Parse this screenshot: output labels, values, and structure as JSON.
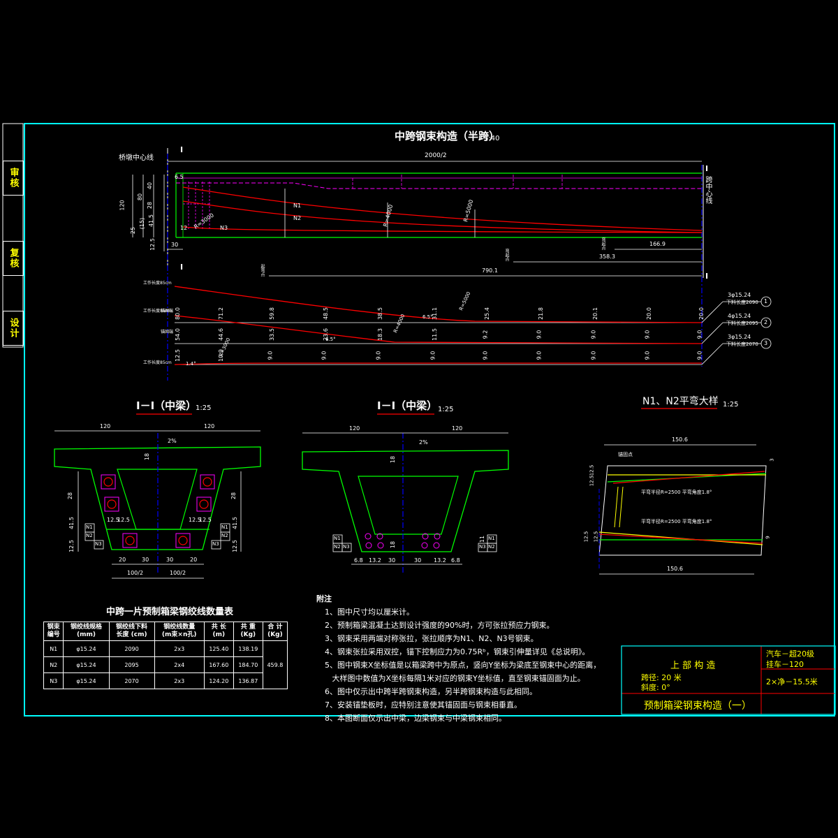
{
  "sidebar": {
    "items": [
      "审核",
      "复核",
      "设计"
    ]
  },
  "main_view": {
    "title": "中跨钢束构造（半跨）",
    "scale": "1:40",
    "span_dim": "2000/2",
    "pier_label": "桥墩中心线",
    "span_center_label": "跨中心线",
    "section_mark": "I",
    "dims_left": [
      "6.5",
      "120",
      "80",
      "40",
      "28",
      "41.5",
      "25",
      "(15)",
      "12.5",
      "12"
    ],
    "dims_bottom": [
      "30",
      "166.9",
      "358.3",
      "790.1"
    ],
    "tendon_labels": [
      "N1",
      "N2",
      "N3"
    ],
    "radius_labels": [
      "R=3000",
      "R=4000",
      "R=5000"
    ],
    "small_labels": [
      "弯起点",
      "弯起点",
      "起弯点"
    ]
  },
  "profiles": {
    "rows": [
      {
        "head": "工作长度85cm",
        "values": [
          "80.0",
          "71.2",
          "59.8",
          "48.5",
          "38.5",
          "31.1",
          "25.4",
          "21.8",
          "20.1",
          "20.0",
          "20.0"
        ],
        "spec": "3φ15.24",
        "length": "下料长度2090",
        "no": "1",
        "extra": "6.5°",
        "radius": "R=5000"
      },
      {
        "head": "工作长度85cm",
        "values": [
          "54.0",
          "44.6",
          "33.5",
          "23.6",
          "18.3",
          "11.5",
          "9.2",
          "9.0",
          "9.0",
          "9.0",
          "9.0"
        ],
        "spec": "4φ15.24",
        "length": "下料长度2095",
        "no": "2",
        "extra": "6.5°",
        "radius": "R=4000"
      },
      {
        "head": "工作长度85cm",
        "values": [
          "12.5",
          "10.9",
          "9.0",
          "9.0",
          "9.0",
          "9.0",
          "9.0",
          "9.0",
          "9.0",
          "9.0",
          "9.0"
        ],
        "spec": "3φ15.24",
        "length": "下料长度2070",
        "no": "3",
        "extra": "1.4°",
        "radius": "R=3000"
      }
    ],
    "row_caption": "锚固端"
  },
  "section_left": {
    "title": "I－I（中梁）",
    "scale": "1:25",
    "top_dims": [
      "120",
      "120"
    ],
    "slope": "2%",
    "dims": [
      "18",
      "28",
      "41.5",
      "12.5",
      "12.5",
      "12.5"
    ],
    "bottom_dims": [
      "20",
      "30",
      "30",
      "20"
    ],
    "half_widths": [
      "100/2",
      "100/2"
    ],
    "tags_left": [
      "N1",
      "N2",
      "N3"
    ],
    "tags_right": [
      "N1",
      "N2",
      "N3"
    ]
  },
  "section_right": {
    "title": "I－I（中梁）",
    "scale": "1:25",
    "top_dims": [
      "120",
      "120"
    ],
    "slope": "2%",
    "dims": [
      "18",
      "18",
      "11"
    ],
    "bottom_dims": [
      "6.8",
      "13.2",
      "30",
      "30",
      "13.2",
      "6.8"
    ],
    "tags_left": [
      "N1",
      "N2",
      "N3"
    ],
    "tags_right": [
      "N1",
      "N2",
      "N3"
    ]
  },
  "detail": {
    "title": "N1、N2平弯大样",
    "scale": "1:25",
    "top_dim": "150.6",
    "bottom_dim": "150.6",
    "anchor_label": "锚固点",
    "note1": "平弯半径R=2500  平弯角度1.8°",
    "note2": "平弯半径R=2500  平弯角度1.8°",
    "side_dims": [
      "12.5",
      "12.5",
      "3",
      "12.5",
      "12.5",
      "9"
    ]
  },
  "table": {
    "title": "中跨一片预制箱梁钢绞线数量表",
    "headers": [
      [
        "钢束",
        "编号"
      ],
      [
        "钢绞线规格",
        "(mm)"
      ],
      [
        "钢绞线下料",
        "长度 (cm)"
      ],
      [
        "钢绞线数量",
        "(m束×n孔)"
      ],
      [
        "共 长",
        "(m)"
      ],
      [
        "共 重",
        "(Kg)"
      ],
      [
        "合 计",
        "(Kg)"
      ]
    ],
    "rows": [
      [
        "N1",
        "φ15.24",
        "2090",
        "2x3",
        "125.40",
        "138.19"
      ],
      [
        "N2",
        "φ15.24",
        "2095",
        "2x4",
        "167.60",
        "184.70"
      ],
      [
        "N3",
        "φ15.24",
        "2070",
        "2x3",
        "124.20",
        "136.87"
      ]
    ],
    "total": "459.8"
  },
  "notes": {
    "head": "附注",
    "items": [
      "1、图中尺寸均以厘米计。",
      "2、预制箱梁混凝土达到设计强度的90%时，方可张拉预应力钢束。",
      "3、钢束采用两端对称张拉，张拉顺序为N1、N2、N3号钢束。",
      "4、钢束张拉采用双控，锚下控制应力为0.75Rᵇ，钢束引伸量详见《总说明》。",
      "5、图中钢束X坐标值是以箱梁跨中为原点，竖向Y坐标为梁底至钢束中心的距离，",
      "   大样图中数值为X坐标每隔1米对应的钢束Y坐标值，直至钢束锚固面为止。",
      "6、图中仅示出中跨半跨钢束构造，另半跨钢束构造与此相同。",
      "7、安装锚垫板时，应特别注意使其锚固面与钢束相垂直。",
      "8、本图断面仅示出中梁，边梁钢束与中梁钢束相同。"
    ]
  },
  "title_block": {
    "project": "上 部 构 造",
    "span": "跨径: 20 米",
    "skew": "斜度: 0°",
    "load1": "汽车－超20级",
    "load2": "挂车－120",
    "width": "2×净－15.5米",
    "drawing_title": "预制箱梁钢束构造（一）"
  },
  "colors": {
    "frame": "#00ffff",
    "green": "#00ff00",
    "red": "#ff0000",
    "magenta": "#ff00ff",
    "blue": "#0000ff",
    "yellow": "#ffff00",
    "white": "#ffffff"
  }
}
